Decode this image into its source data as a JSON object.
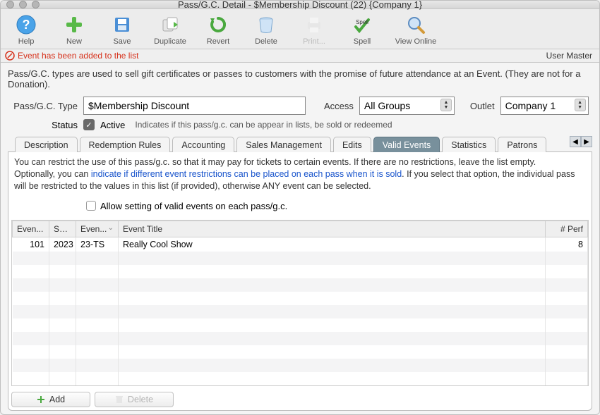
{
  "title": "Pass/G.C. Detail - $Membership Discount (22) {Company 1}",
  "toolbar": {
    "help": "Help",
    "new": "New",
    "save": "Save",
    "duplicate": "Duplicate",
    "revert": "Revert",
    "delete": "Delete",
    "print": "Print...",
    "spell": "Spell",
    "viewonline": "View Online"
  },
  "status_msg": "Event has been added to the list",
  "user_label": "User Master",
  "description": "Pass/G.C. types are used to sell gift certificates or passes to customers with the promise of future attendance at an Event.  (They are not for a Donation).",
  "form": {
    "type_label": "Pass/G.C. Type",
    "type_value": "$Membership Discount",
    "access_label": "Access",
    "access_value": "All Groups",
    "outlet_label": "Outlet",
    "outlet_value": "Company 1",
    "status_label": "Status",
    "active_label": "Active",
    "active_hint": "Indicates if this pass/g.c. can be appear in lists, be sold or redeemed"
  },
  "tabs": {
    "items": [
      "Description",
      "Redemption Rules",
      "Accounting",
      "Sales Management",
      "Edits",
      "Valid Events",
      "Statistics",
      "Patrons"
    ],
    "active_index": 5
  },
  "panel": {
    "line1": "You can restrict the use of this pass/g.c. so that it may pay for tickets to certain events.   If there are no restrictions, leave the list empty.",
    "line2a": "Optionally, you can ",
    "line2_link": "indicate if different event restrictions can be placed on each pass when it is sold",
    "line2b": ".  If you select that option, the individual pass will be restricted to the values in this list (if provided), otherwise ANY event can be selected.",
    "allow_label": "Allow setting of valid events on each pass/g.c."
  },
  "grid": {
    "headers": {
      "c1": "Even...",
      "c2": "Sea...",
      "c3": "Even...",
      "c4": "Event Title",
      "c5": "# Perf"
    },
    "rows": [
      {
        "event_no": "101",
        "season": "2023",
        "event_code": "23-TS",
        "title": "Really Cool Show",
        "perf": "8"
      }
    ]
  },
  "buttons": {
    "add": "Add",
    "delete": "Delete"
  }
}
